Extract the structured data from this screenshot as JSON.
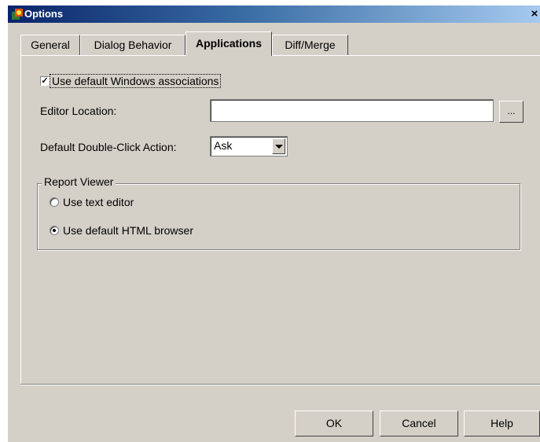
{
  "window": {
    "title": "Options"
  },
  "tabs": [
    {
      "label": "General"
    },
    {
      "label": "Dialog Behavior"
    },
    {
      "label": "Applications",
      "active": true
    },
    {
      "label": "Diff/Merge"
    }
  ],
  "applications": {
    "use_default_windows_associations": {
      "label": "Use default Windows associations",
      "checked": true
    },
    "editor_location": {
      "label": "Editor Location:",
      "value": "",
      "browse_label": "..."
    },
    "default_double_click": {
      "label": "Default Double-Click Action:",
      "value": "Ask"
    },
    "report_viewer": {
      "title": "Report Viewer",
      "options": [
        {
          "label": "Use text editor",
          "checked": false
        },
        {
          "label": "Use default HTML browser",
          "checked": true
        }
      ]
    }
  },
  "buttons": {
    "ok": "OK",
    "cancel": "Cancel",
    "help": "Help"
  },
  "icons": {
    "app": "options-app-icon",
    "close": "close-icon",
    "dropdown": "chevron-down-icon"
  }
}
